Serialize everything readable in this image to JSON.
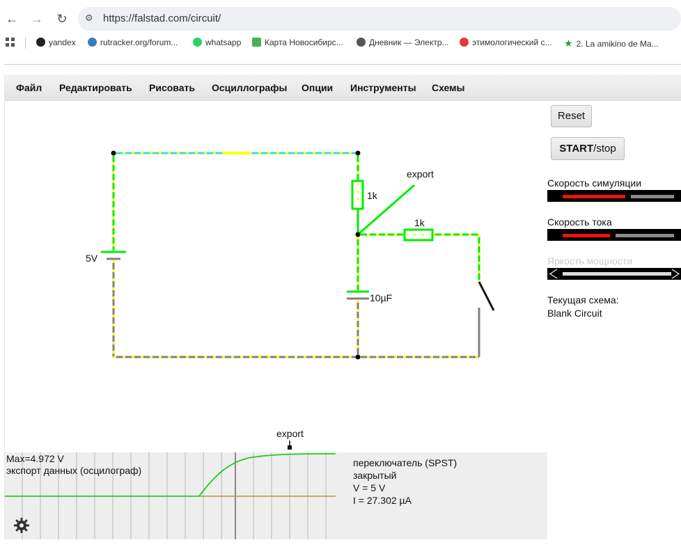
{
  "browser": {
    "url": "https://falstad.com/circuit/",
    "bookmarks": [
      {
        "label": "yandex",
        "color": "#222222"
      },
      {
        "label": "rutracker.org/forum...",
        "color": "#3b7bbf"
      },
      {
        "label": "whatsapp",
        "color": "#25d366"
      },
      {
        "label": "Карта Новосибирс...",
        "color": "#4caf50"
      },
      {
        "label": "Дневник — Электр...",
        "color": "#555555"
      },
      {
        "label": "этимологический с...",
        "color": "#e53935"
      },
      {
        "label": "2. La amikino de Ma...",
        "color": "#1b9e3e"
      }
    ]
  },
  "menu": [
    "Файл",
    "Редактировать",
    "Рисовать",
    "Осциллографы",
    "Опции",
    "Инструменты",
    "Схемы"
  ],
  "circuit": {
    "battery_label": "5V",
    "resistor1_label": "1k",
    "resistor2_label": "1k",
    "capacitor_label": "10µF",
    "probe_label": "export"
  },
  "panel": {
    "reset_label": "Reset",
    "start_label": "START",
    "stop_label": "/stop",
    "sim_speed_label": "Скорость симуляции",
    "sim_speed_level": 0.6,
    "current_speed_label": "Скорость тока",
    "current_speed_level": 0.45,
    "power_brightness_label": "Яркость мощности",
    "current_circuit_label": "Текущая схема:",
    "current_circuit_name": "Blank Circuit"
  },
  "scope": {
    "probe_label": "export",
    "max_label": "Max=4.972 V",
    "title": "экспорт данных (осцилограф)",
    "info": [
      "переключатель (SPST)",
      "закрытый",
      "V = 5 V",
      "I = 27.302 µA"
    ]
  },
  "colors": {
    "wire_live": "#00ee00",
    "wire_ground": "#808080",
    "wire_mid": "#33dddd",
    "current_dots": "#ffff00",
    "slider_fill": "#ee1111"
  }
}
